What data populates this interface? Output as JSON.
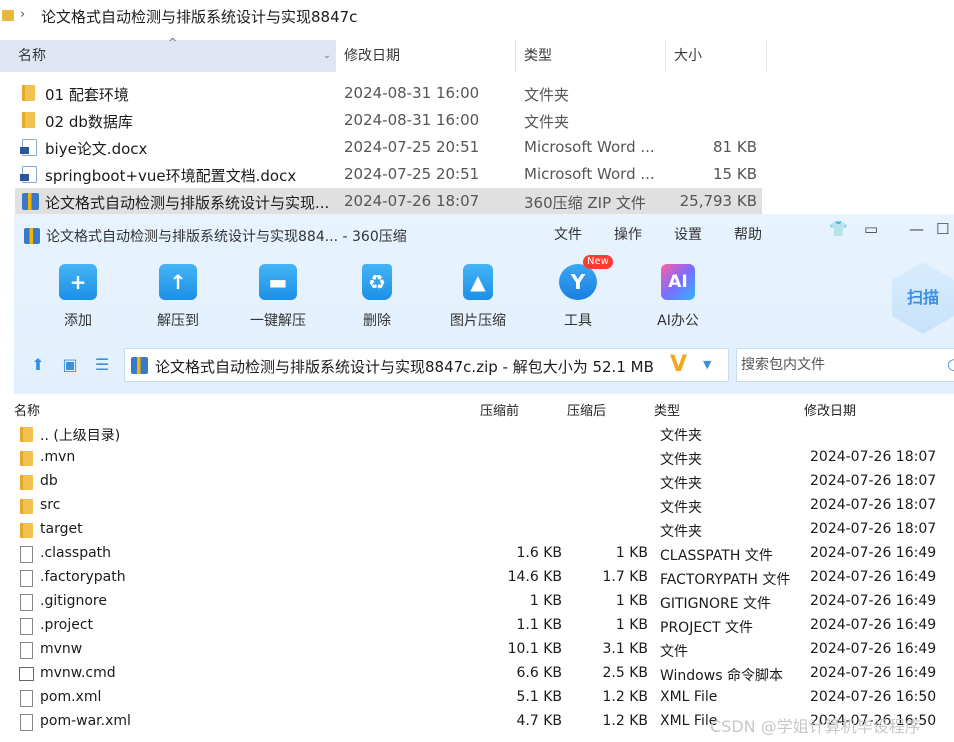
{
  "explorer": {
    "path": "论文格式自动检测与排版系统设计与实现8847c",
    "columns": {
      "name": "名称",
      "modified": "修改日期",
      "type": "类型",
      "size": "大小"
    },
    "rows": [
      {
        "name": "01 配套环境",
        "date": "2024-08-31 16:00",
        "type": "文件夹",
        "size": "",
        "icon": "folder-icon"
      },
      {
        "name": "02 db数据库",
        "date": "2024-08-31 16:00",
        "type": "文件夹",
        "size": "",
        "icon": "folder-icon"
      },
      {
        "name": "biye论文.docx",
        "date": "2024-07-25 20:51",
        "type": "Microsoft Word ...",
        "size": "81 KB",
        "icon": "word-doc-icon"
      },
      {
        "name": "springboot+vue环境配置文档.docx",
        "date": "2024-07-25 20:51",
        "type": "Microsoft Word ...",
        "size": "15 KB",
        "icon": "word-doc-icon"
      },
      {
        "name": "论文格式自动检测与排版系统设计与实现...",
        "date": "2024-07-26 18:07",
        "type": "360压缩 ZIP 文件",
        "size": "25,793 KB",
        "icon": "zip-archive-icon",
        "selected": true
      }
    ]
  },
  "zip_window": {
    "title": "论文格式自动检测与排版系统设计与实现884... - 360压缩",
    "menu": [
      "文件",
      "操作",
      "设置",
      "帮助"
    ],
    "toolbar": [
      {
        "label": "添加",
        "icon": "add-icon"
      },
      {
        "label": "解压到",
        "icon": "extract-to-icon"
      },
      {
        "label": "一键解压",
        "icon": "one-click-extract-icon"
      },
      {
        "label": "删除",
        "icon": "delete-icon"
      },
      {
        "label": "图片压缩",
        "icon": "image-compress-icon"
      },
      {
        "label": "工具",
        "icon": "tools-icon"
      },
      {
        "label": "AI办公",
        "icon": "ai-office-icon"
      }
    ],
    "new_badge": "New",
    "scan_label": "扫描",
    "archive_path": "论文格式自动检测与排版系统设计与实现8847c.zip - 解包大小为 52.1 MB",
    "search_placeholder": "搜索包内文件",
    "list_headers": {
      "name": "名称",
      "before": "压缩前",
      "after": "压缩后",
      "type": "类型",
      "modified": "修改日期"
    },
    "files": [
      {
        "name": ".. (上级目录)",
        "before": "",
        "after": "",
        "type": "文件夹",
        "date": "",
        "icon": "folder-icon"
      },
      {
        "name": ".mvn",
        "before": "",
        "after": "",
        "type": "文件夹",
        "date": "2024-07-26 18:07",
        "icon": "folder-icon"
      },
      {
        "name": "db",
        "before": "",
        "after": "",
        "type": "文件夹",
        "date": "2024-07-26 18:07",
        "icon": "folder-icon"
      },
      {
        "name": "src",
        "before": "",
        "after": "",
        "type": "文件夹",
        "date": "2024-07-26 18:07",
        "icon": "folder-icon"
      },
      {
        "name": "target",
        "before": "",
        "after": "",
        "type": "文件夹",
        "date": "2024-07-26 18:07",
        "icon": "folder-icon"
      },
      {
        "name": ".classpath",
        "before": "1.6 KB",
        "after": "1 KB",
        "type": "CLASSPATH 文件",
        "date": "2024-07-26 16:49",
        "icon": "file-icon"
      },
      {
        "name": ".factorypath",
        "before": "14.6 KB",
        "after": "1.7 KB",
        "type": "FACTORYPATH 文件",
        "date": "2024-07-26 16:49",
        "icon": "file-icon"
      },
      {
        "name": ".gitignore",
        "before": "1 KB",
        "after": "1 KB",
        "type": "GITIGNORE 文件",
        "date": "2024-07-26 16:49",
        "icon": "file-icon"
      },
      {
        "name": ".project",
        "before": "1.1 KB",
        "after": "1 KB",
        "type": "PROJECT 文件",
        "date": "2024-07-26 16:49",
        "icon": "file-icon"
      },
      {
        "name": "mvnw",
        "before": "10.1 KB",
        "after": "3.1 KB",
        "type": "文件",
        "date": "2024-07-26 16:49",
        "icon": "file-icon"
      },
      {
        "name": "mvnw.cmd",
        "before": "6.6 KB",
        "after": "2.5 KB",
        "type": "Windows 命令脚本",
        "date": "2024-07-26 16:49",
        "icon": "cmd-script-icon"
      },
      {
        "name": "pom.xml",
        "before": "5.1 KB",
        "after": "1.2 KB",
        "type": "XML File",
        "date": "2024-07-26 16:50",
        "icon": "file-icon"
      },
      {
        "name": "pom-war.xml",
        "before": "4.7 KB",
        "after": "1.2 KB",
        "type": "XML File",
        "date": "2024-07-26 16:50",
        "icon": "file-icon"
      }
    ]
  },
  "watermark": "CSDN @学姐计算机毕设程序"
}
